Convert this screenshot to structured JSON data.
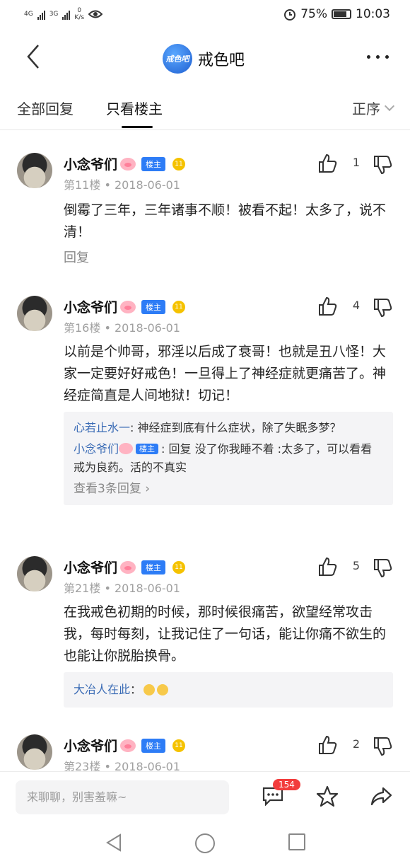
{
  "status_bar": {
    "net_left": "4G",
    "net_right": "3G",
    "speed_value": "0",
    "speed_unit": "K/s",
    "battery": "75%",
    "time": "10:03"
  },
  "header": {
    "logo_text": "戒色吧",
    "title": "戒色吧"
  },
  "tabs": {
    "all_replies": "全部回复",
    "only_op": "只看楼主",
    "order": "正序"
  },
  "posts": [
    {
      "user": "小念爷们",
      "badge": "楼主",
      "level": "11",
      "meta": "第11楼 • 2018-06-01",
      "likes": "1",
      "content": "倒霉了三年，三年诸事不顺！被看不起！太多了，说不清！",
      "reply_label": "回复"
    },
    {
      "user": "小念爷们",
      "badge": "楼主",
      "level": "11",
      "meta": "第16楼 • 2018-06-01",
      "likes": "4",
      "content": "以前是个帅哥，邪淫以后成了衰哥！也就是丑八怪！大家一定要好好戒色！一旦得上了神经症就更痛苦了。神经症简直是人间地狱！切记！",
      "sub_replies": [
        {
          "name": "心若止水一",
          "sep": ": ",
          "text": "神经症到底有什么症状，除了失眠多梦？"
        },
        {
          "name": "小念爷们",
          "badge": "楼主",
          "sep": ": ",
          "text": "回复 没了你我睡不着 :太多了，可以看看戒为良药。活的不真实"
        }
      ],
      "more_replies": "查看3条回复 ›"
    },
    {
      "user": "小念爷们",
      "badge": "楼主",
      "level": "11",
      "meta": "第21楼 • 2018-06-01",
      "likes": "5",
      "content": "在我戒色初期的时候，那时候很痛苦，欲望经常攻击我，每时每刻，让我记住了一句话，能让你痛不欲生的也能让你脱胎换骨。",
      "sub_replies": [
        {
          "name": "大冶人在此",
          "sep": "：",
          "text": ""
        }
      ]
    },
    {
      "user": "小念爷们",
      "badge": "楼主",
      "level": "11",
      "meta": "第23楼 • 2018-06-01",
      "likes": "2"
    }
  ],
  "bottom_bar": {
    "placeholder": "来聊聊，别害羞嘛~",
    "notification_count": "154"
  }
}
